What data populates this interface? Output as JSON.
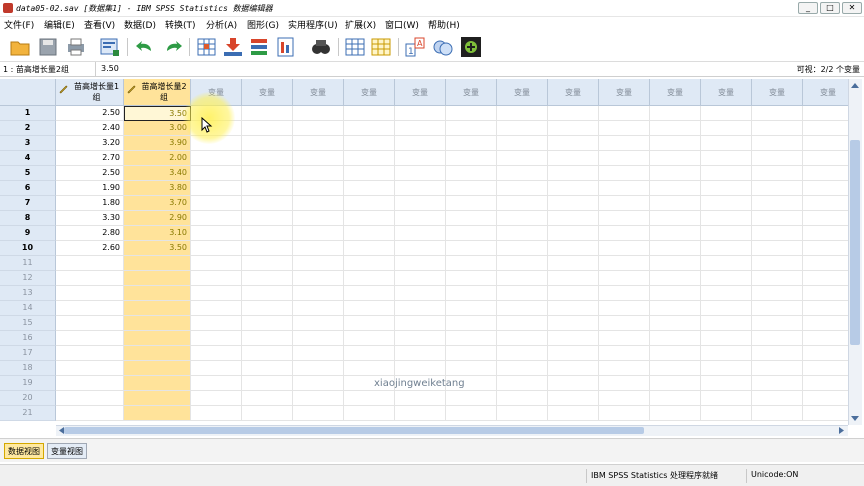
{
  "window": {
    "title": "data05-02.sav [数据集1] - IBM SPSS Statistics 数据编辑器",
    "controls": [
      "_",
      "□",
      "✕"
    ]
  },
  "menu": [
    "文件(F)",
    "编辑(E)",
    "查看(V)",
    "数据(D)",
    "转换(T)",
    "分析(A)",
    "图形(G)",
    "实用程序(U)",
    "扩展(X)",
    "窗口(W)",
    "帮助(H)"
  ],
  "toolbar": {
    "icons": [
      "open-folder-icon",
      "save-icon",
      "print-icon",
      "dialog-recall-icon",
      "undo-icon",
      "redo-icon",
      "goto-case-icon",
      "goto-variable-icon",
      "variables-icon",
      "run-descriptives-icon",
      "find-icon",
      "insert-cases-icon",
      "insert-variable-icon",
      "split-file-icon",
      "weight-cases-icon",
      "select-cases-icon",
      "value-labels-icon"
    ]
  },
  "cellbar": {
    "cell_ref": "1 : 苗高增长量2组",
    "cell_value": "3.50",
    "visible": "可视：2/2 个变量"
  },
  "grid": {
    "columns": [
      "苗高增长量1组",
      "苗高增长量2组",
      "变量",
      "变量",
      "变量",
      "变量",
      "变量",
      "变量",
      "变量",
      "变量",
      "变量",
      "变量",
      "变量",
      "变量",
      "变量"
    ],
    "row_numbers": [
      "1",
      "2",
      "3",
      "4",
      "5",
      "6",
      "7",
      "8",
      "9",
      "10",
      "11",
      "12",
      "13",
      "14",
      "15",
      "16",
      "17",
      "18",
      "19",
      "20",
      "21"
    ],
    "rows": [
      [
        "2.50",
        "3.50"
      ],
      [
        "2.40",
        "3.00"
      ],
      [
        "3.20",
        "3.90"
      ],
      [
        "2.70",
        "2.00"
      ],
      [
        "2.50",
        "3.40"
      ],
      [
        "1.90",
        "3.80"
      ],
      [
        "1.80",
        "3.70"
      ],
      [
        "3.30",
        "2.90"
      ],
      [
        "2.80",
        "3.10"
      ],
      [
        "2.60",
        "3.50"
      ]
    ]
  },
  "tabs": [
    "数据视图",
    "变量视图"
  ],
  "status": {
    "processor": "IBM SPSS Statistics 处理程序就绪",
    "unicode": "Unicode:ON"
  },
  "watermark": "xiaojingweiketang",
  "colors": {
    "header_bg": "#dfe9f5",
    "selected_column": "#ffe39a",
    "scroll_thumb": "#b7cbe6"
  }
}
